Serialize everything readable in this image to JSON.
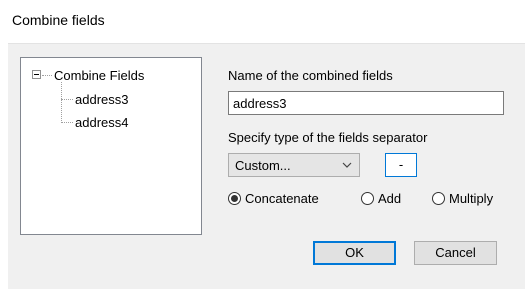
{
  "window": {
    "title": "Combine fields"
  },
  "tree": {
    "root": "Combine Fields",
    "children": [
      "address3",
      "address4"
    ]
  },
  "name_label": "Name of the combined fields",
  "name_value": "address3",
  "separator_label": "Specify type of the fields separator",
  "separator_type": "Custom...",
  "separator_value": "-",
  "options": [
    {
      "label": "Concatenate",
      "selected": true
    },
    {
      "label": "Add",
      "selected": false
    },
    {
      "label": "Multiply",
      "selected": false
    }
  ],
  "buttons": {
    "ok": "OK",
    "cancel": "Cancel"
  },
  "colors": {
    "focus": "#0078d7",
    "dialog_bg": "#f0f0f0"
  },
  "icons": {
    "expander": "minus-box-icon",
    "combo_arrow": "chevron-down-icon"
  }
}
